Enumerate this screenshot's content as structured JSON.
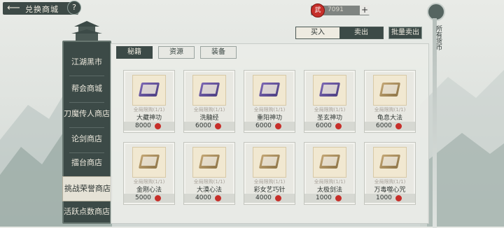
{
  "header": {
    "back_icon": "arrow-left-icon",
    "title": "兑换商城",
    "help": "?"
  },
  "currency": {
    "icon": "red-token-icon",
    "token_char": "武",
    "amount": "7091",
    "plus": "+"
  },
  "right_rail": {
    "label": "所有货币"
  },
  "nav": {
    "items": [
      {
        "label": "江湖黑市",
        "active": false
      },
      {
        "label": "帮会商城",
        "active": false
      },
      {
        "label": "刀魔传人商店",
        "active": false
      },
      {
        "label": "论剑商店",
        "active": false
      },
      {
        "label": "擂台商店",
        "active": false
      },
      {
        "label": "挑战荣誉商店",
        "active": true
      },
      {
        "label": "活跃点数商店",
        "active": false
      }
    ]
  },
  "trade": {
    "buy": "买入",
    "sell": "卖出",
    "batch_sell": "批量卖出"
  },
  "tabs": [
    {
      "label": "秘籍",
      "active": true
    },
    {
      "label": "资源",
      "active": false
    },
    {
      "label": "装备",
      "active": false
    }
  ],
  "items": [
    {
      "name": "大藏神功",
      "limit": "全局限购(1/1)",
      "price": "8000",
      "color": "purple"
    },
    {
      "name": "洗髓经",
      "limit": "全局限购(1/1)",
      "price": "6000",
      "color": "purple"
    },
    {
      "name": "重阳神功",
      "limit": "全局限购(1/1)",
      "price": "6000",
      "color": "purple"
    },
    {
      "name": "圣玄神功",
      "limit": "全局限购(1/1)",
      "price": "6000",
      "color": "purple"
    },
    {
      "name": "龟息大法",
      "limit": "全局限购(1/1)",
      "price": "6000",
      "color": "tan"
    },
    {
      "name": "金刚心法",
      "limit": "全局限购(1/1)",
      "price": "5000",
      "color": "tan"
    },
    {
      "name": "大漠心法",
      "limit": "全局限购(1/1)",
      "price": "4000",
      "color": "tan"
    },
    {
      "name": "彩女艺巧针",
      "limit": "全局限购(1/1)",
      "price": "4000",
      "color": "tan"
    },
    {
      "name": "太极剑法",
      "limit": "全局限购(1/1)",
      "price": "1000",
      "color": "tan"
    },
    {
      "name": "万毒噬心咒",
      "limit": "全局限购(1/1)",
      "price": "1000",
      "color": "tan"
    }
  ],
  "colors": {
    "dark": "#3c4a47",
    "coin": "#c62f2a",
    "panel": "#eaece8"
  }
}
